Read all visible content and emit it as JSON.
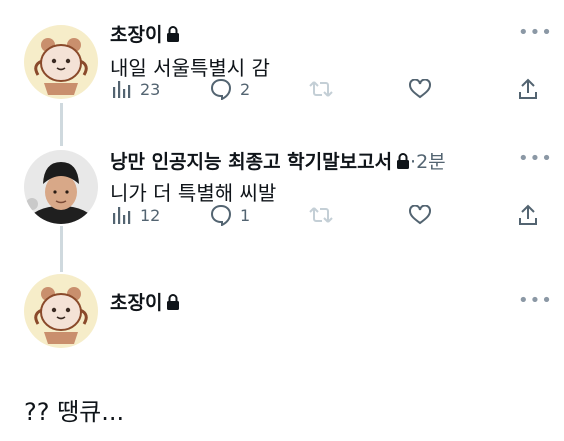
{
  "tweets": [
    {
      "author": "초장이",
      "locked": true,
      "time": "",
      "text": "내일 서울특별시 감",
      "stats": {
        "views": "23",
        "replies": "2",
        "retweets": "",
        "likes": ""
      }
    },
    {
      "author": "낭만 인공지능 최종고 학기말보고서",
      "locked": true,
      "time": "·2분",
      "text": "니가 더 특별해 씨발",
      "stats": {
        "views": "12",
        "replies": "1",
        "retweets": "",
        "likes": ""
      }
    },
    {
      "author": "초장이",
      "locked": true
    }
  ],
  "reply_text": "?? 땡큐...",
  "icons": [
    "more-icon",
    "lock-icon",
    "views-icon",
    "reply-icon",
    "retweet-icon",
    "like-icon",
    "share-icon"
  ],
  "colors": {
    "text": "#0f1419",
    "muted": "#536471",
    "thread_line": "#cfd9de",
    "avatar_bg": "#f6edc9"
  }
}
